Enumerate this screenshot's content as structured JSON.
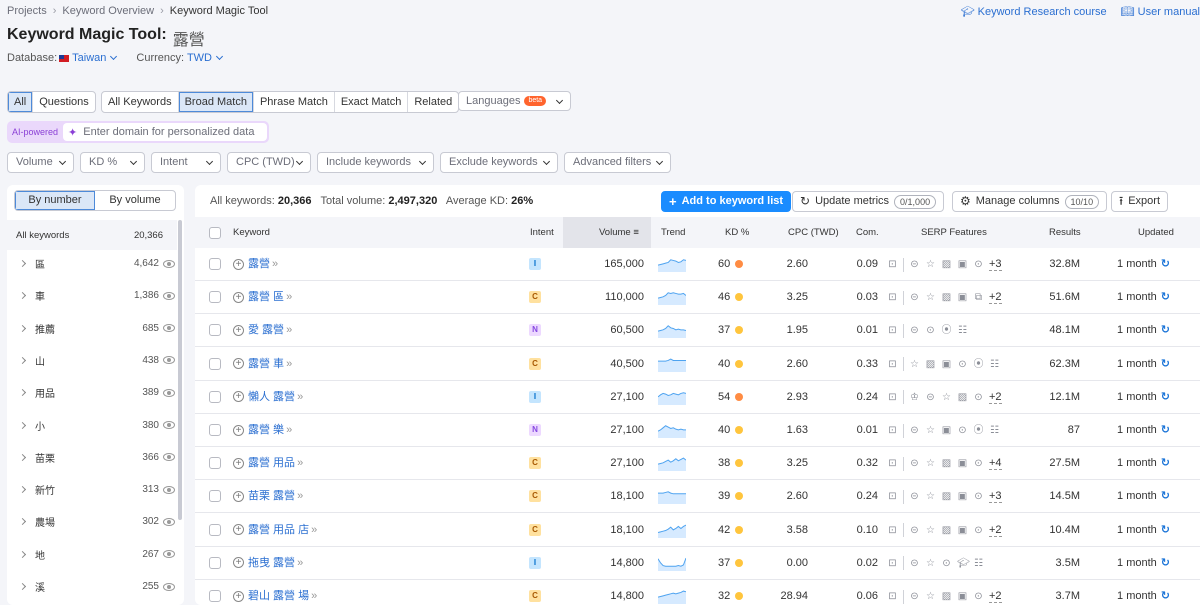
{
  "breadcrumb": [
    "Projects",
    "Keyword Overview",
    "Keyword Magic Tool"
  ],
  "top_links": {
    "course": "Keyword Research course",
    "manual": "User manual"
  },
  "title": {
    "label": "Keyword Magic Tool:",
    "keyword": "露營"
  },
  "database": {
    "label": "Database:",
    "value": "Taiwan"
  },
  "currency": {
    "label": "Currency:",
    "value": "TWD"
  },
  "question_tabs": [
    {
      "label": "All",
      "active": true
    },
    {
      "label": "Questions",
      "active": false
    }
  ],
  "match_tabs": [
    {
      "label": "All Keywords",
      "active": false
    },
    {
      "label": "Broad Match",
      "active": true
    },
    {
      "label": "Phrase Match",
      "active": false
    },
    {
      "label": "Exact Match",
      "active": false
    },
    {
      "label": "Related",
      "active": false
    }
  ],
  "languages": {
    "label": "Languages",
    "badge": "beta"
  },
  "ai": {
    "label": "AI-powered",
    "placeholder": "Enter domain for personalized data"
  },
  "filters": [
    "Volume",
    "KD %",
    "Intent",
    "CPC (TWD)",
    "Include keywords",
    "Exclude keywords",
    "Advanced filters"
  ],
  "sidebar": {
    "toggle": [
      {
        "label": "By number",
        "active": true
      },
      {
        "label": "By volume",
        "active": false
      }
    ],
    "all": {
      "label": "All keywords",
      "count": "20,366"
    },
    "groups": [
      {
        "name": "區",
        "count": "4,642"
      },
      {
        "name": "車",
        "count": "1,386"
      },
      {
        "name": "推薦",
        "count": "685"
      },
      {
        "name": "山",
        "count": "438"
      },
      {
        "name": "用品",
        "count": "389"
      },
      {
        "name": "小",
        "count": "380"
      },
      {
        "name": "苗栗",
        "count": "366"
      },
      {
        "name": "新竹",
        "count": "313"
      },
      {
        "name": "農場",
        "count": "302"
      },
      {
        "name": "地",
        "count": "267"
      },
      {
        "name": "溪",
        "count": "255"
      }
    ]
  },
  "summary": {
    "all_label": "All keywords:",
    "all_value": "20,366",
    "volume_label": "Total volume:",
    "volume_value": "2,497,320",
    "kd_label": "Average KD:",
    "kd_value": "26%"
  },
  "actions": {
    "add": "Add to keyword list",
    "update": "Update metrics",
    "update_count": "0/1,000",
    "manage": "Manage columns",
    "manage_count": "10/10",
    "export": "Export"
  },
  "columns": [
    "Keyword",
    "Intent",
    "Volume",
    "Trend",
    "KD %",
    "CPC (TWD)",
    "Com.",
    "SERP Features",
    "Results",
    "Updated"
  ],
  "intent_colors": {
    "I": {
      "bg": "#c4e5fe",
      "fg": "#006dca"
    },
    "C": {
      "bg": "#ffe19f",
      "fg": "#a75800"
    },
    "N": {
      "bg": "#edd9ff",
      "fg": "#8649e1"
    }
  },
  "kd_colors": {
    "orange": "#ff8c43",
    "yellow": "#ffc53d"
  },
  "rows": [
    {
      "keyword": "露營",
      "intent": "I",
      "volume": "165,000",
      "trend": [
        0.5,
        0.55,
        0.6,
        0.65,
        0.7,
        0.9,
        0.85,
        0.8,
        0.7,
        0.75,
        0.9,
        0.85
      ],
      "kd": "60",
      "kd_color": "orange",
      "cpc": "2.60",
      "com": "0.09",
      "serp": [
        "link",
        "star",
        "image",
        "image2",
        "video"
      ],
      "more": "+3",
      "results": "32.8M",
      "updated": "1 month"
    },
    {
      "keyword": "露營 區",
      "intent": "C",
      "volume": "110,000",
      "trend": [
        0.5,
        0.55,
        0.6,
        0.7,
        0.9,
        0.85,
        0.9,
        0.85,
        0.8,
        0.8,
        0.85,
        0.7
      ],
      "kd": "46",
      "kd_color": "yellow",
      "cpc": "3.25",
      "com": "0.03",
      "serp": [
        "link",
        "star",
        "image",
        "image2",
        "carousel"
      ],
      "more": "+2",
      "results": "51.6M",
      "updated": "1 month"
    },
    {
      "keyword": "愛 露營",
      "intent": "N",
      "volume": "60,500",
      "trend": [
        0.5,
        0.55,
        0.6,
        0.7,
        0.9,
        0.75,
        0.7,
        0.6,
        0.65,
        0.6,
        0.6,
        0.55
      ],
      "kd": "37",
      "kd_color": "yellow",
      "cpc": "1.95",
      "com": "0.01",
      "serp": [
        "link",
        "video",
        "pin",
        "list"
      ],
      "more": "",
      "results": "48.1M",
      "updated": "1 month"
    },
    {
      "keyword": "露營 車",
      "intent": "C",
      "volume": "40,500",
      "trend": [
        0.8,
        0.8,
        0.8,
        0.8,
        0.85,
        0.95,
        0.85,
        0.85,
        0.85,
        0.85,
        0.85,
        0.85
      ],
      "kd": "40",
      "kd_color": "yellow",
      "cpc": "2.60",
      "com": "0.33",
      "serp": [
        "star",
        "image",
        "image2",
        "video",
        "pin",
        "list"
      ],
      "more": "",
      "results": "62.3M",
      "updated": "1 month"
    },
    {
      "keyword": "懶人 露營",
      "intent": "I",
      "volume": "27,100",
      "trend": [
        0.6,
        0.75,
        0.85,
        0.8,
        0.7,
        0.75,
        0.85,
        0.8,
        0.75,
        0.85,
        0.9,
        0.85
      ],
      "kd": "54",
      "kd_color": "orange",
      "cpc": "2.93",
      "com": "0.24",
      "serp": [
        "crown",
        "link",
        "star",
        "image",
        "video"
      ],
      "more": "+2",
      "results": "12.1M",
      "updated": "1 month"
    },
    {
      "keyword": "露營 樂",
      "intent": "N",
      "volume": "27,100",
      "trend": [
        0.5,
        0.6,
        0.75,
        0.9,
        0.8,
        0.7,
        0.75,
        0.65,
        0.6,
        0.65,
        0.6,
        0.6
      ],
      "kd": "40",
      "kd_color": "yellow",
      "cpc": "1.63",
      "com": "0.01",
      "serp": [
        "link",
        "star",
        "image2",
        "video",
        "pin",
        "list"
      ],
      "more": "",
      "results": "87",
      "updated": "1 month"
    },
    {
      "keyword": "露營 用品",
      "intent": "C",
      "volume": "27,100",
      "trend": [
        0.5,
        0.55,
        0.6,
        0.7,
        0.8,
        0.65,
        0.75,
        0.9,
        0.75,
        0.85,
        0.95,
        0.8
      ],
      "kd": "38",
      "kd_color": "yellow",
      "cpc": "3.25",
      "com": "0.32",
      "serp": [
        "link",
        "star",
        "image",
        "image2",
        "video"
      ],
      "more": "+4",
      "results": "27.5M",
      "updated": "1 month"
    },
    {
      "keyword": "苗栗 露營",
      "intent": "C",
      "volume": "18,100",
      "trend": [
        0.8,
        0.8,
        0.8,
        0.85,
        0.9,
        0.8,
        0.75,
        0.75,
        0.75,
        0.75,
        0.75,
        0.75
      ],
      "kd": "39",
      "kd_color": "yellow",
      "cpc": "2.60",
      "com": "0.24",
      "serp": [
        "link",
        "star",
        "image",
        "image2",
        "video"
      ],
      "more": "+3",
      "results": "14.5M",
      "updated": "1 month"
    },
    {
      "keyword": "露營 用品 店",
      "intent": "C",
      "volume": "18,100",
      "trend": [
        0.4,
        0.45,
        0.5,
        0.55,
        0.65,
        0.8,
        0.6,
        0.7,
        0.85,
        0.7,
        0.85,
        0.95
      ],
      "kd": "42",
      "kd_color": "yellow",
      "cpc": "3.58",
      "com": "0.10",
      "serp": [
        "link",
        "star",
        "image",
        "image2",
        "video"
      ],
      "more": "+2",
      "results": "10.4M",
      "updated": "1 month"
    },
    {
      "keyword": "拖曳 露營",
      "intent": "I",
      "volume": "14,800",
      "trend": [
        0.9,
        0.6,
        0.4,
        0.35,
        0.35,
        0.35,
        0.35,
        0.35,
        0.4,
        0.35,
        0.45,
        0.95
      ],
      "kd": "37",
      "kd_color": "yellow",
      "cpc": "0.00",
      "com": "0.02",
      "serp": [
        "link",
        "star",
        "video",
        "cap",
        "list"
      ],
      "more": "",
      "results": "3.5M",
      "updated": "1 month"
    },
    {
      "keyword": "碧山 露營 場",
      "intent": "C",
      "volume": "14,800",
      "trend": [
        0.5,
        0.55,
        0.6,
        0.65,
        0.7,
        0.75,
        0.8,
        0.75,
        0.8,
        0.85,
        0.95,
        0.9
      ],
      "kd": "32",
      "kd_color": "yellow",
      "cpc": "28.94",
      "com": "0.06",
      "serp": [
        "link",
        "star",
        "image",
        "image2",
        "video"
      ],
      "more": "+2",
      "results": "3.7M",
      "updated": "1 month"
    }
  ]
}
